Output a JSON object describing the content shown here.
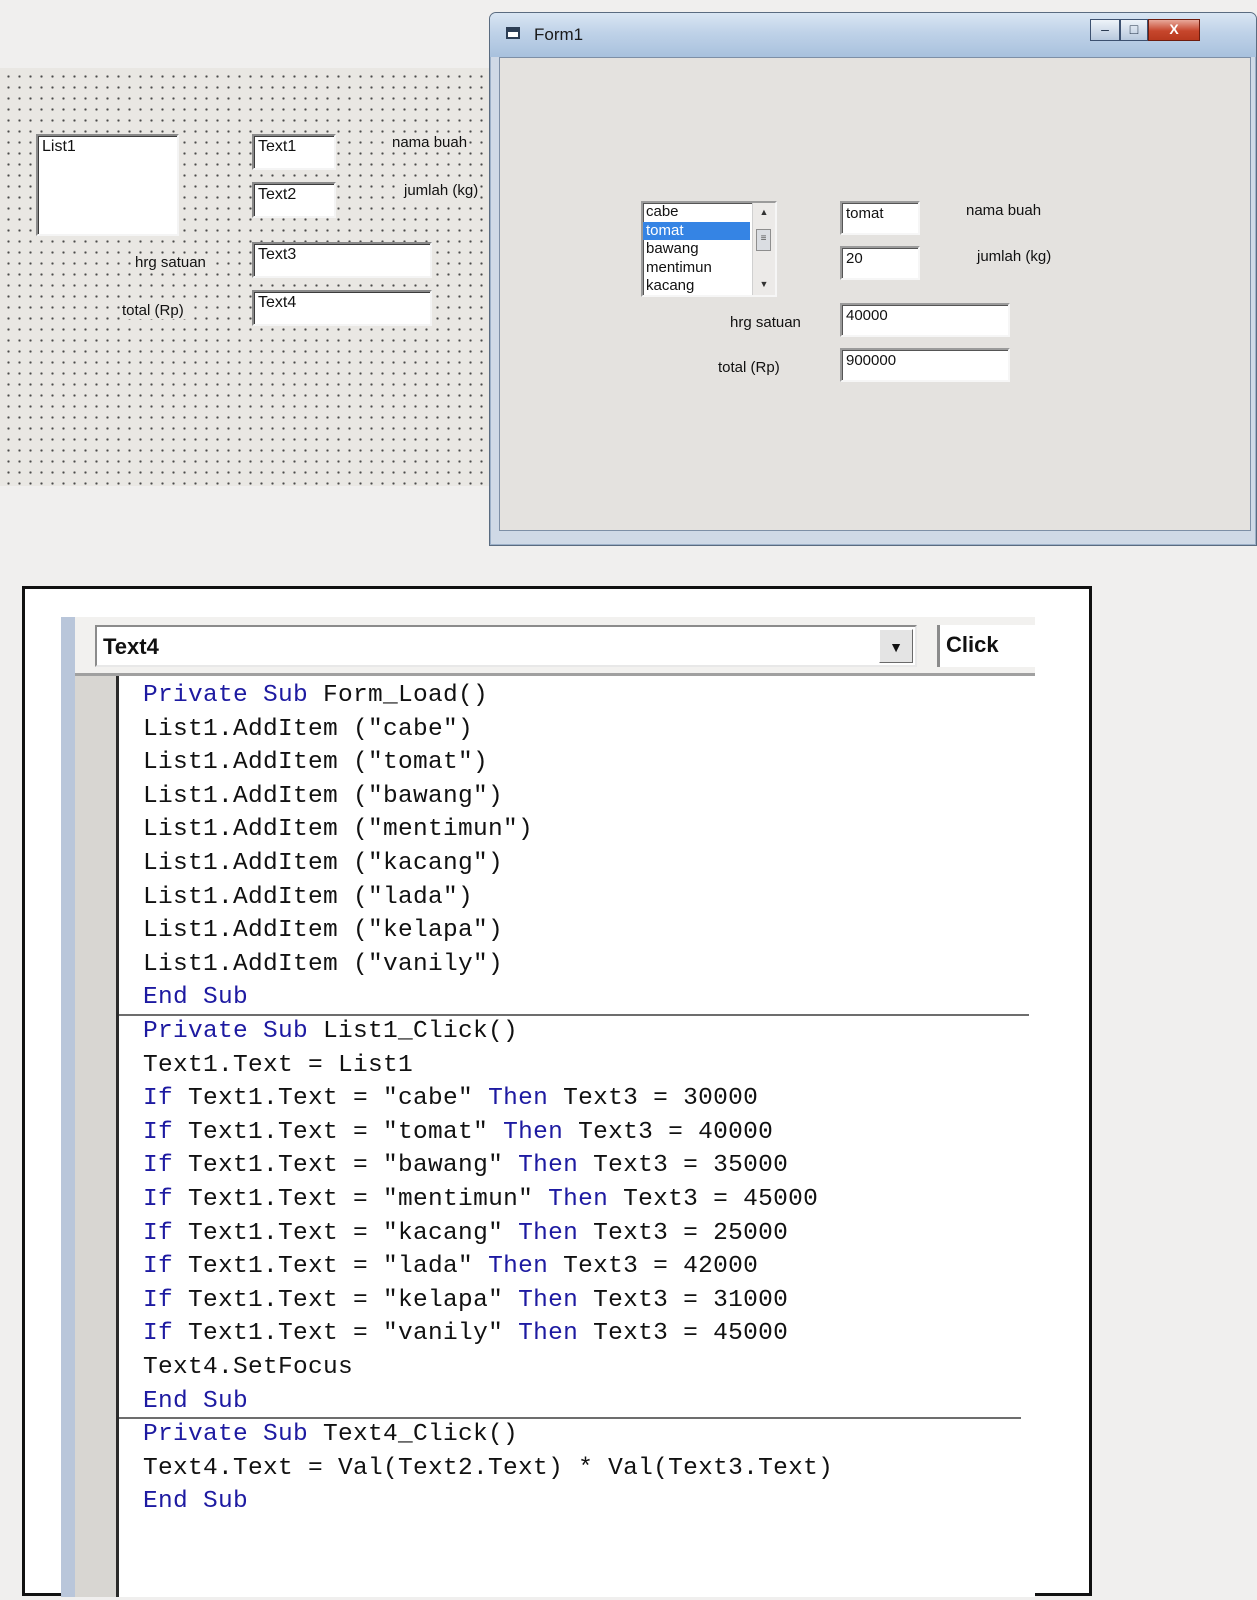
{
  "designer": {
    "list_label": "List1",
    "text1": "Text1",
    "text2": "Text2",
    "text3": "Text3",
    "text4": "Text4",
    "label_nama": "nama buah",
    "label_jumlah": "jumlah (kg)",
    "label_harga": "hrg satuan",
    "label_total": "total (Rp)"
  },
  "form1": {
    "title": "Form1",
    "controls": {
      "minimize": "–",
      "maximize": "□",
      "close": "X"
    },
    "list_items": [
      {
        "label": "cabe",
        "selected": false
      },
      {
        "label": "tomat",
        "selected": true
      },
      {
        "label": "bawang",
        "selected": false
      },
      {
        "label": "mentimun",
        "selected": false
      },
      {
        "label": "kacang",
        "selected": false
      }
    ],
    "text1": "tomat",
    "text2": "20",
    "text3": "40000",
    "text4": "900000",
    "label_nama": "nama buah",
    "label_jumlah": "jumlah (kg)",
    "label_harga": "hrg satuan",
    "label_total": "total (Rp)",
    "selection_color": "#3584e4"
  },
  "code_window": {
    "object": "Text4",
    "event": "Click",
    "keyword_color": "#1d1aa1",
    "lines": [
      [
        {
          "k": "Private Sub"
        },
        {
          "t": " Form_Load()"
        }
      ],
      [
        {
          "t": "List1.AddItem (\"cabe\")"
        }
      ],
      [
        {
          "t": "List1.AddItem (\"tomat\")"
        }
      ],
      [
        {
          "t": "List1.AddItem (\"bawang\")"
        }
      ],
      [
        {
          "t": "List1.AddItem (\"mentimun\")"
        }
      ],
      [
        {
          "t": "List1.AddItem (\"kacang\")"
        }
      ],
      [
        {
          "t": "List1.AddItem (\"lada\")"
        }
      ],
      [
        {
          "t": "List1.AddItem (\"kelapa\")"
        }
      ],
      [
        {
          "t": "List1.AddItem (\"vanily\")"
        }
      ],
      [
        {
          "k": "End Sub"
        }
      ],
      [
        {
          "k": "Private Sub"
        },
        {
          "t": " List1_Click()"
        }
      ],
      [
        {
          "t": "Text1.Text = List1"
        }
      ],
      [
        {
          "k": "If"
        },
        {
          "t": " Text1.Text = \"cabe\" "
        },
        {
          "k": "Then"
        },
        {
          "t": " Text3 = 30000"
        }
      ],
      [
        {
          "k": "If"
        },
        {
          "t": " Text1.Text = \"tomat\" "
        },
        {
          "k": "Then"
        },
        {
          "t": " Text3 = 40000"
        }
      ],
      [
        {
          "k": "If"
        },
        {
          "t": " Text1.Text = \"bawang\" "
        },
        {
          "k": "Then"
        },
        {
          "t": " Text3 = 35000"
        }
      ],
      [
        {
          "k": "If"
        },
        {
          "t": " Text1.Text = \"mentimun\" "
        },
        {
          "k": "Then"
        },
        {
          "t": " Text3 = 45000"
        }
      ],
      [
        {
          "k": "If"
        },
        {
          "t": " Text1.Text = \"kacang\" "
        },
        {
          "k": "Then"
        },
        {
          "t": " Text3 = 25000"
        }
      ],
      [
        {
          "k": "If"
        },
        {
          "t": " Text1.Text = \"lada\" "
        },
        {
          "k": "Then"
        },
        {
          "t": " Text3 = 42000"
        }
      ],
      [
        {
          "k": "If"
        },
        {
          "t": " Text1.Text = \"kelapa\" "
        },
        {
          "k": "Then"
        },
        {
          "t": " Text3 = 31000"
        }
      ],
      [
        {
          "k": "If"
        },
        {
          "t": " Text1.Text = \"vanily\" "
        },
        {
          "k": "Then"
        },
        {
          "t": " Text3 = 45000"
        }
      ],
      [
        {
          "t": "Text4.SetFocus"
        }
      ],
      [
        {
          "k": "End Sub"
        }
      ],
      [
        {
          "k": "Private Sub"
        },
        {
          "t": " Text4_Click()"
        }
      ],
      [
        {
          "t": "Text4.Text = Val(Text2.Text) * Val(Text3.Text)"
        }
      ],
      [
        {
          "k": "End Sub"
        }
      ]
    ],
    "separators_after": [
      9,
      21
    ]
  }
}
